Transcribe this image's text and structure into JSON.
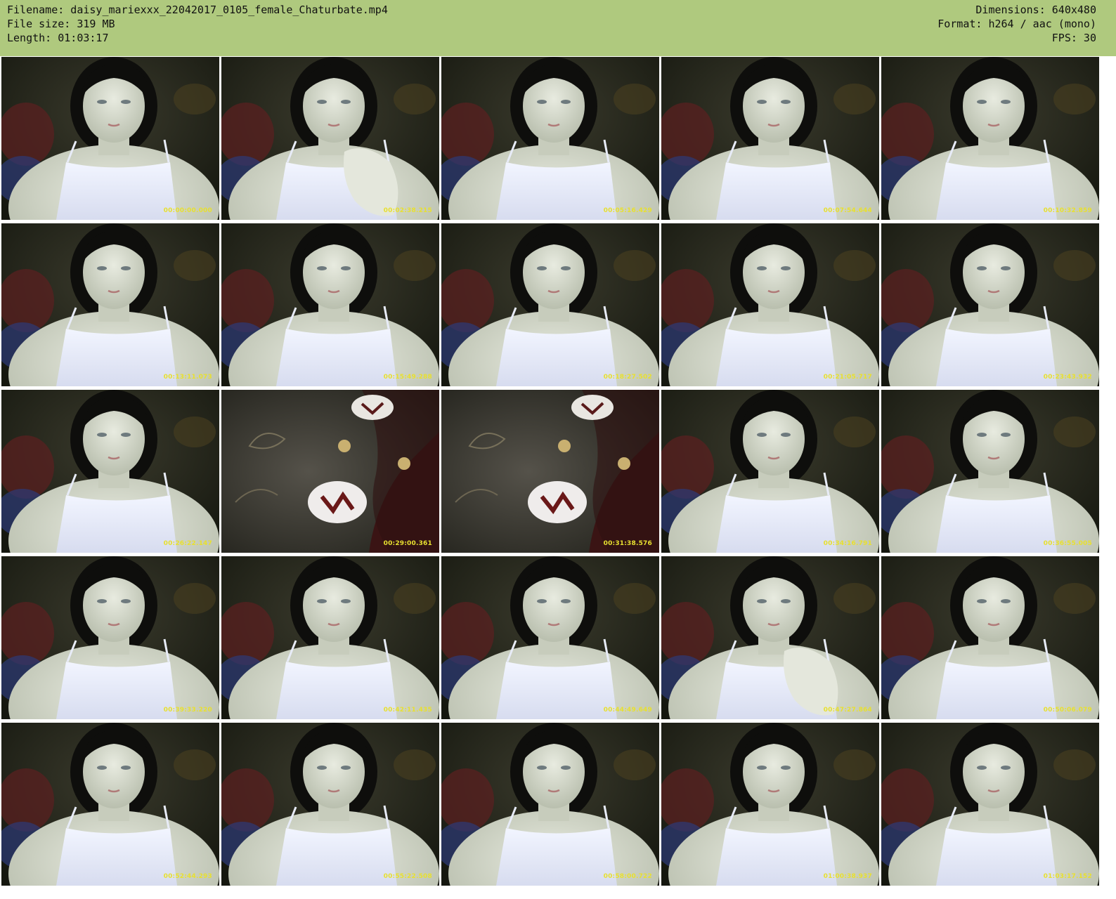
{
  "header": {
    "filename_line": "Filename: daisy_mariexxx_22042017_0105_female_Chaturbate.mp4",
    "filesize_line": "File size: 319 MB",
    "length_line": "Length: 01:03:17",
    "dimensions_line": "Dimensions: 640x480",
    "format_line": "Format: h264 / aac (mono)",
    "fps_line": "FPS: 30"
  },
  "colors": {
    "header_bg": "#afc97e",
    "timestamp": "#e8e030"
  },
  "thumbnails": [
    {
      "scene": "person",
      "timestamp": "00:00:00.000"
    },
    {
      "scene": "person-hand",
      "timestamp": "00:02:38.215"
    },
    {
      "scene": "person",
      "timestamp": "00:05:16.429"
    },
    {
      "scene": "person",
      "timestamp": "00:07:54.644"
    },
    {
      "scene": "person",
      "timestamp": "00:10:32.859"
    },
    {
      "scene": "person",
      "timestamp": "00:13:11.073"
    },
    {
      "scene": "person",
      "timestamp": "00:15:49.288"
    },
    {
      "scene": "person",
      "timestamp": "00:18:27.502"
    },
    {
      "scene": "person",
      "timestamp": "00:21:05.717"
    },
    {
      "scene": "person",
      "timestamp": "00:23:43.932"
    },
    {
      "scene": "person",
      "timestamp": "00:26:22.147"
    },
    {
      "scene": "blanket",
      "timestamp": "00:29:00.361"
    },
    {
      "scene": "blanket",
      "timestamp": "00:31:38.576"
    },
    {
      "scene": "person",
      "timestamp": "00:34:16.791"
    },
    {
      "scene": "person",
      "timestamp": "00:36:55.005"
    },
    {
      "scene": "person",
      "timestamp": "00:39:33.220"
    },
    {
      "scene": "person",
      "timestamp": "00:42:11.435"
    },
    {
      "scene": "person",
      "timestamp": "00:44:49.649"
    },
    {
      "scene": "person-hand",
      "timestamp": "00:47:27.864"
    },
    {
      "scene": "person",
      "timestamp": "00:50:06.079"
    },
    {
      "scene": "person",
      "timestamp": "00:52:44.293"
    },
    {
      "scene": "person",
      "timestamp": "00:55:22.508"
    },
    {
      "scene": "person",
      "timestamp": "00:58:00.722"
    },
    {
      "scene": "person",
      "timestamp": "01:00:38.937"
    },
    {
      "scene": "person",
      "timestamp": "01:03:17.152"
    }
  ]
}
